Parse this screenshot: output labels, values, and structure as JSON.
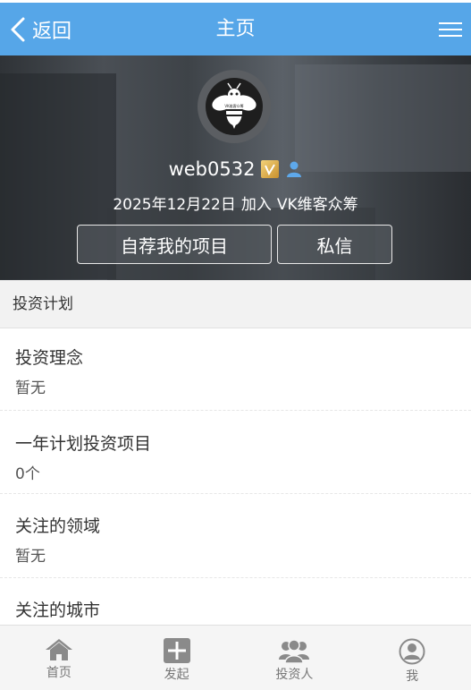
{
  "nav": {
    "back_label": "返回",
    "title": "主页"
  },
  "profile": {
    "username": "web0532",
    "badge_icon": "v-badge-icon",
    "verified_icon": "person-icon",
    "join_date": "2025年12月22日",
    "join_text": "加入",
    "platform": "VK维客众筹",
    "avatar_text": "VK维客众筹",
    "buttons": {
      "recommend": "自荐我的项目",
      "message": "私信"
    }
  },
  "investment_plan": {
    "header": "投资计划",
    "items": [
      {
        "label": "投资理念",
        "value": "暂无"
      },
      {
        "label": "一年计划投资项目",
        "value": "0个"
      },
      {
        "label": "关注的领域",
        "value": "暂无"
      },
      {
        "label": "关注的城市",
        "value": ""
      }
    ]
  },
  "tabbar": {
    "items": [
      {
        "label": "首页",
        "icon": "home-icon"
      },
      {
        "label": "发起",
        "icon": "plus-icon"
      },
      {
        "label": "投资人",
        "icon": "investors-icon"
      },
      {
        "label": "我",
        "icon": "user-icon"
      }
    ]
  },
  "colors": {
    "nav_bg": "#56a6e8",
    "section_bg": "#f2f2f2",
    "tab_icon": "#8a8a8a"
  }
}
